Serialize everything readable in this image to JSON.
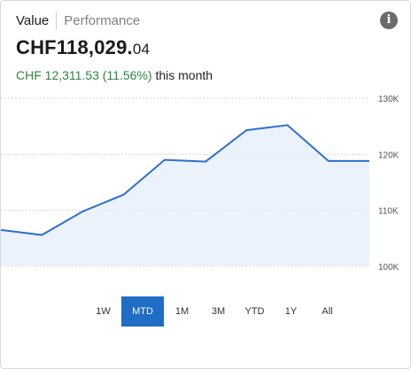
{
  "tabs": [
    {
      "label": "Value",
      "active": true
    },
    {
      "label": "Performance",
      "active": false
    }
  ],
  "info_icon": {
    "glyph": "i",
    "name": "info-icon"
  },
  "balance": {
    "main": "CHF118,029.",
    "cents": "04"
  },
  "change": {
    "delta": "CHF 12,311.53 (11.56%)",
    "suffix": "this month"
  },
  "ranges": [
    "1W",
    "MTD",
    "1M",
    "3M",
    "YTD",
    "1Y",
    "All"
  ],
  "selected_range": "MTD",
  "colors": {
    "line": "#2f6fcf",
    "fill": "#e8f0fb",
    "selected": "#1f6dc4",
    "positive": "#2e8540"
  },
  "chart_data": {
    "type": "area",
    "x": [
      0,
      1,
      2,
      3,
      4,
      5,
      6,
      7,
      8,
      9
    ],
    "values": [
      106500,
      105600,
      109800,
      112800,
      119000,
      118700,
      124300,
      125200,
      118800,
      118800
    ],
    "y_ticks": [
      100000,
      110000,
      120000,
      130000
    ],
    "y_tick_labels": [
      "100K",
      "110K",
      "120K",
      "130K"
    ],
    "ylim": [
      100000,
      130000
    ],
    "grid": true,
    "title": "",
    "xlabel": "",
    "ylabel": ""
  }
}
